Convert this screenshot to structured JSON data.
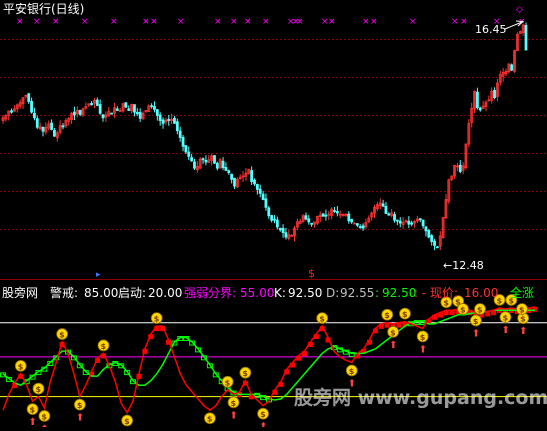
{
  "main_panel": {
    "title": "平安银行(日线)",
    "price_high_label": "16.45",
    "price_low_label": "←12.48",
    "high_arrow": "←",
    "dollar_marker": "$"
  },
  "indicator_panel": {
    "site_label": "股旁网",
    "warn_label": "警戒:",
    "warn_value": "85.00",
    "start_label": "启动:",
    "start_value": "20.00",
    "split_label": "强弱分界:",
    "split_value": "55.00",
    "k_label": "K:",
    "k_value": "92.50",
    "d_label": "D:",
    "d_value": "92.55",
    "j_prefix": ":",
    "j_value": "92.50",
    "price_label": ": - 现价:",
    "price_value": "16.00",
    "tag_label": "全涨"
  },
  "watermark": "股旁网 www.gupang.com",
  "colors": {
    "background": "#000000",
    "grid": "#8b0000",
    "up_candle": "#ff3232",
    "down_candle": "#54ffff",
    "x_marker": "#ff00ff",
    "warn_line": "#ffffff",
    "split_line": "#ff00ff",
    "start_line": "#ffff00",
    "k_line": "#ff0000",
    "d_line": "#00ff00",
    "coin": "#ffd700"
  },
  "chart_data": {
    "type": "candlestick",
    "title": "平安银行(日线)",
    "price_ylim": [
      12.0,
      16.75
    ],
    "labeled_high": 16.45,
    "labeled_low": 12.48,
    "close_series": [
      14.79,
      14.83,
      14.91,
      14.89,
      14.95,
      15.02,
      15.06,
      15.15,
      15.19,
      15.08,
      14.89,
      14.79,
      14.62,
      14.63,
      14.55,
      14.62,
      14.68,
      14.58,
      14.46,
      14.52,
      14.65,
      14.63,
      14.74,
      14.78,
      14.87,
      14.84,
      14.92,
      14.85,
      14.95,
      14.99,
      15.04,
      15.02,
      15.1,
      15.01,
      14.87,
      14.79,
      14.84,
      14.9,
      14.87,
      14.97,
      14.92,
      14.92,
      15.04,
      14.98,
      14.92,
      15.03,
      14.89,
      14.86,
      14.78,
      14.87,
      14.92,
      15.0,
      14.99,
      14.94,
      14.83,
      14.74,
      14.69,
      14.75,
      14.74,
      14.76,
      14.69,
      14.56,
      14.44,
      14.28,
      14.18,
      14.1,
      14.02,
      13.89,
      13.92,
      14.05,
      14.04,
      14.0,
      14.04,
      14.11,
      13.98,
      13.89,
      14.04,
      13.9,
      13.85,
      13.81,
      13.69,
      13.57,
      13.69,
      13.73,
      13.75,
      13.8,
      13.87,
      13.65,
      13.61,
      13.51,
      13.44,
      13.33,
      13.19,
      13.04,
      12.96,
      12.96,
      12.84,
      12.79,
      12.74,
      12.66,
      12.7,
      12.69,
      12.82,
      12.93,
      12.94,
      13.04,
      12.98,
      12.93,
      12.89,
      12.93,
      13.03,
      13.05,
      13.03,
      13.04,
      13.07,
      13.16,
      13.13,
      13.09,
      13.07,
      13.06,
      13.07,
      12.95,
      12.93,
      12.91,
      12.87,
      12.84,
      12.82,
      12.92,
      13.0,
      13.09,
      13.19,
      13.24,
      13.27,
      13.21,
      13.08,
      13.05,
      13.09,
      12.96,
      12.95,
      12.91,
      12.92,
      12.95,
      12.89,
      12.89,
      12.94,
      12.98,
      12.97,
      12.86,
      12.77,
      12.66,
      12.58,
      12.51,
      12.48,
      12.68,
      13.01,
      13.33,
      13.68,
      13.75,
      13.94,
      13.93,
      13.83,
      13.93,
      14.32,
      14.69,
      14.96,
      15.26,
      14.97,
      14.93,
      15.0,
      15.07,
      15.11,
      15.26,
      15.15,
      15.41,
      15.56,
      15.6,
      15.62,
      15.75,
      15.64,
      15.99,
      16.28,
      16.33,
      16.45,
      16.0
    ],
    "indicator_ylim": [
      -5,
      105
    ],
    "reference_lines": {
      "warn": 85.0,
      "split": 55.0,
      "start": 20.0
    },
    "series": [
      {
        "name": "K",
        "values": [
          8,
          22,
          32,
          40,
          30,
          16,
          20,
          10,
          33,
          50,
          68,
          58,
          40,
          20,
          30,
          42,
          54,
          58,
          47,
          33,
          14,
          6,
          16,
          40,
          62,
          75,
          82,
          82,
          70,
          55,
          40,
          30,
          24,
          18,
          12,
          8,
          12,
          20,
          26,
          22,
          24,
          34,
          22,
          17,
          12,
          16,
          26,
          33,
          44,
          50,
          56,
          60,
          68,
          75,
          82,
          72,
          60,
          55,
          52,
          50,
          58,
          62,
          70,
          80,
          84,
          85,
          84,
          85,
          86,
          84,
          82,
          80,
          88,
          92,
          94,
          96,
          96,
          97,
          97,
          96,
          94,
          94,
          95,
          96,
          98,
          97,
          98,
          97,
          96,
          98,
          99
        ]
      },
      {
        "name": "D",
        "values": [
          40,
          36,
          32,
          30,
          34,
          38,
          42,
          45,
          50,
          55,
          60,
          60,
          55,
          48,
          42,
          38,
          38,
          44,
          48,
          50,
          48,
          42,
          34,
          30,
          30,
          34,
          40,
          48,
          58,
          68,
          72,
          72,
          68,
          62,
          55,
          48,
          40,
          34,
          28,
          24,
          22,
          22,
          22,
          22,
          20,
          18,
          17,
          18,
          22,
          28,
          34,
          40,
          46,
          52,
          58,
          62,
          64,
          62,
          60,
          58,
          58,
          58,
          60,
          62,
          66,
          70,
          74,
          78,
          82,
          85,
          86,
          86,
          84,
          84,
          86,
          88,
          90,
          92,
          92,
          93,
          94,
          94,
          95,
          96,
          96,
          96,
          96,
          96,
          96,
          96,
          96
        ]
      },
      {
        "name": "J",
        "values": [
          92.5
        ]
      }
    ],
    "current_values": {
      "K": 92.5,
      "D": 92.55,
      "J": 92.5,
      "price": 16.0
    }
  }
}
